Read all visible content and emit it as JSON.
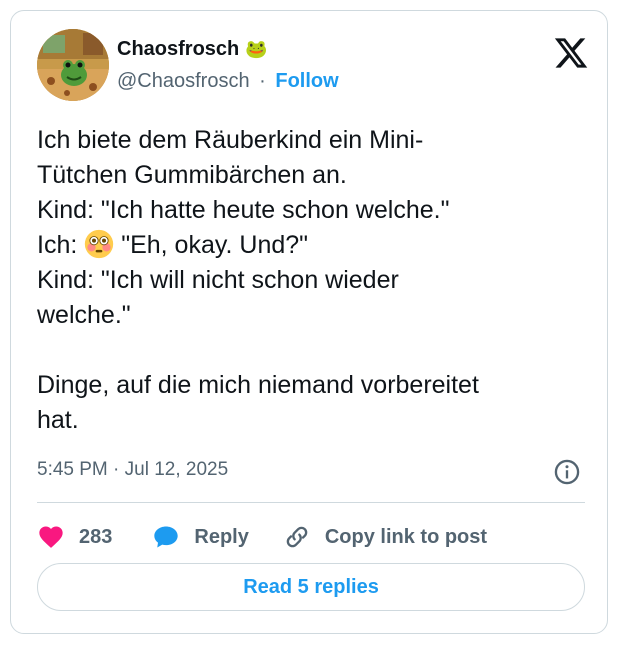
{
  "author": {
    "display_name": "Chaosfrosch",
    "name_badge": "🐸",
    "handle": "@Chaosfrosch",
    "separator": "·",
    "follow_label": "Follow",
    "avatar_icon": "frog-avatar"
  },
  "tweet": {
    "text": "Ich biete dem Räuberkind ein Mini-\nTütchen Gummibärchen an.\nKind: \"Ich hatte heute schon welche.\"\nIch: {EMOJI} \"Eh, okay. Und?\"\nKind: \"Ich will nicht schon wieder\nwelche.\"\n\nDinge, auf die mich niemand vorbereitet\nhat.",
    "text_before_emoji": "Ich biete dem Räuberkind ein Mini-\nTütchen Gummibärchen an.\nKind: \"Ich hatte heute schon welche.\"\nIch: ",
    "emoji_name": "flushed-face-emoji",
    "text_after_emoji": " \"Eh, okay. Und?\"\nKind: \"Ich will nicht schon wieder\nwelche.\"\n\nDinge, auf die mich niemand vorbereitet\nhat.",
    "timestamp": "5:45 PM · Jul 12, 2025"
  },
  "actions": {
    "like_count": "283",
    "reply_label": "Reply",
    "copy_link_label": "Copy link to post",
    "read_replies_label": "Read 5 replies"
  },
  "colors": {
    "accent": "#1d9bf0",
    "like": "#f91880",
    "secondary_text": "#536471",
    "border": "#cfd9de"
  }
}
